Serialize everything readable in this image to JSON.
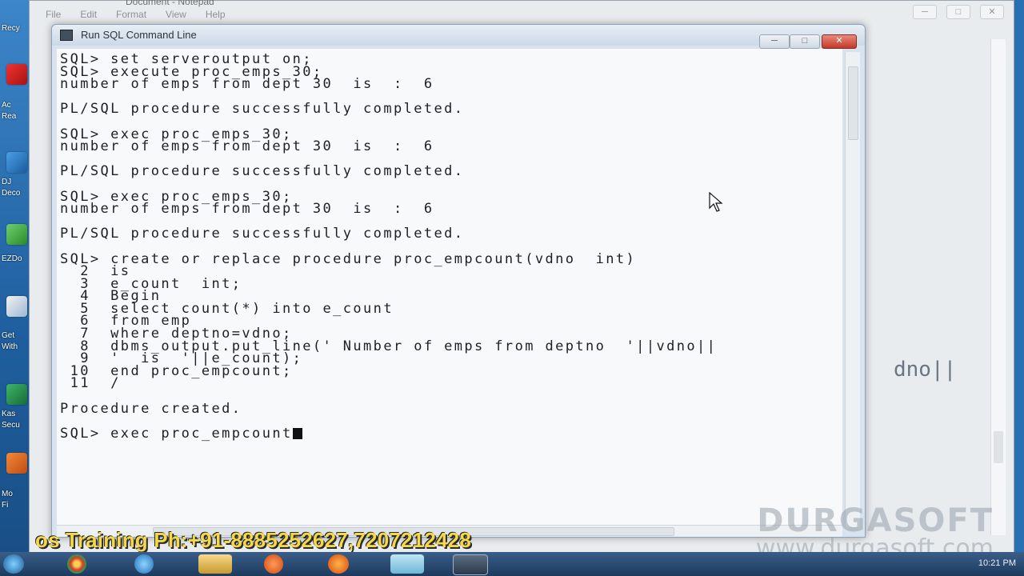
{
  "desktop": {
    "labels": [
      "Recy",
      "Ac",
      "Rea",
      "DJ",
      "Deco",
      "EZDo",
      "Get",
      "With",
      "Kas",
      "Secu",
      "Mo",
      "Fi"
    ]
  },
  "notepad": {
    "title": "Document - Notepad",
    "menu": [
      "File",
      "Edit",
      "Format",
      "View",
      "Help"
    ],
    "visible_text": "dno||"
  },
  "sql_window": {
    "title": "Run SQL Command Line",
    "minimize": "─",
    "maximize": "□",
    "close": "✕",
    "lines": [
      "SQL> set serveroutput on;",
      "SQL> execute proc_emps_30;",
      "number of emps from dept 30  is  :  6",
      "",
      "PL/SQL procedure successfully completed.",
      "",
      "SQL> exec proc_emps_30;",
      "number of emps from dept 30  is  :  6",
      "",
      "PL/SQL procedure successfully completed.",
      "",
      "SQL> exec proc_emps_30;",
      "number of emps from dept 30  is  :  6",
      "",
      "PL/SQL procedure successfully completed.",
      "",
      "SQL> create or replace procedure proc_empcount(vdno  int)",
      "  2  is",
      "  3  e_count  int;",
      "  4  Begin",
      "  5  select count(*) into e_count",
      "  6  from emp",
      "  7  where deptno=vdno;",
      "  8  dbms_output.put_line(' Number of emps from deptno  '||vdno||",
      "  9  '  is  '||e_count);",
      " 10  end proc_empcount;",
      " 11  /",
      "",
      "Procedure created.",
      "",
      "SQL> exec proc_empcount"
    ]
  },
  "banner": {
    "text": "os Training Ph:+91-8885252627,7207212428"
  },
  "watermark": {
    "title": "DURGASOFT",
    "url": "www.durgasoft.com"
  },
  "taskbar": {
    "clock": "10:21 PM"
  }
}
